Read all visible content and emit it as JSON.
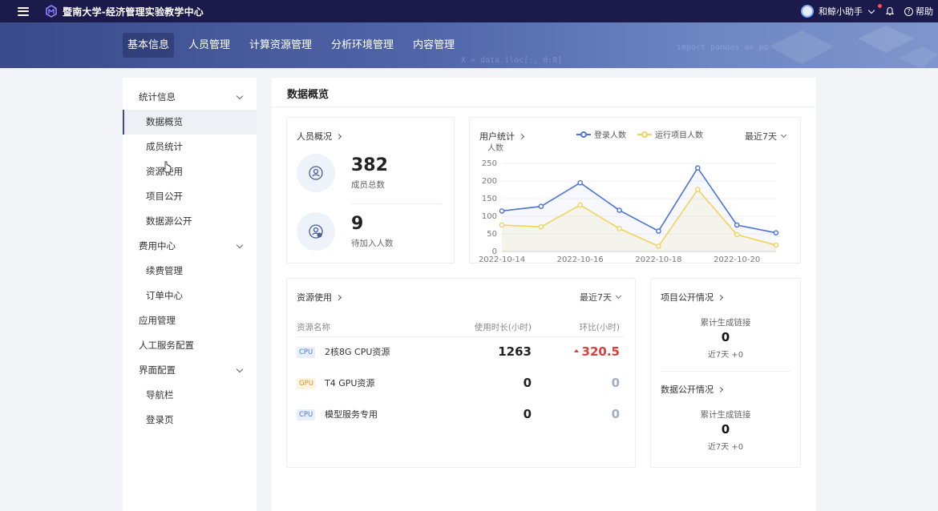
{
  "app": {
    "title": "暨南大学-经济管理实验教学中心"
  },
  "topbar": {
    "user": "和鲸小助手",
    "help": "帮助"
  },
  "nav": {
    "tabs": [
      {
        "label": "基本信息",
        "active": true
      },
      {
        "label": "人员管理"
      },
      {
        "label": "计算资源管理"
      },
      {
        "label": "分析环境管理"
      },
      {
        "label": "内容管理"
      }
    ],
    "deco_code_1": "import pandas as pd",
    "deco_code_2": "X = data.iloc[:, 0:8]"
  },
  "sidebar": {
    "groups": [
      {
        "label": "统计信息",
        "items": [
          "数据概览",
          "成员统计",
          "资源使用",
          "项目公开",
          "数据源公开"
        ]
      },
      {
        "label": "费用中心",
        "items": [
          "续费管理",
          "订单中心"
        ]
      },
      {
        "label": "应用管理"
      },
      {
        "label": "人工服务配置"
      },
      {
        "label": "界面配置",
        "items": [
          "导航栏",
          "登录页"
        ]
      }
    ]
  },
  "main": {
    "title": "数据概览"
  },
  "personnel": {
    "title": "人员概况",
    "members_total": "382",
    "members_label": "成员总数",
    "pending": "9",
    "pending_label": "待加入人数"
  },
  "user_stats": {
    "title": "用户统计",
    "range": "最近7天"
  },
  "chart_data": {
    "type": "line",
    "ylabel": "人数",
    "ylim": [
      0,
      250
    ],
    "yticks": [
      0,
      50,
      100,
      150,
      200,
      250
    ],
    "x": [
      "2022-10-14",
      "2022-10-15",
      "2022-10-16",
      "2022-10-17",
      "2022-10-18",
      "2022-10-19",
      "2022-10-20",
      "2022-10-21"
    ],
    "xtick_labels": [
      "2022-10-14",
      "2022-10-16",
      "2022-10-18",
      "2022-10-20"
    ],
    "series": [
      {
        "name": "登录人数",
        "color": "#4a72d8",
        "values": [
          115,
          128,
          195,
          117,
          58,
          237,
          75,
          53
        ]
      },
      {
        "name": "运行项目人数",
        "color": "#efd35a",
        "values": [
          75,
          70,
          132,
          65,
          15,
          176,
          48,
          18
        ]
      }
    ],
    "grid": true,
    "legend": "top"
  },
  "resources": {
    "title": "资源使用",
    "range": "最近7天",
    "columns": [
      "资源名称",
      "使用时长(小时)",
      "环比(小时)"
    ],
    "rows": [
      {
        "tag": "CPU",
        "name": "2核8G CPU资源",
        "hours": "1263",
        "ratio": "320.5",
        "trend": "up"
      },
      {
        "tag": "GPU",
        "name": "T4 GPU资源",
        "hours": "0",
        "ratio": "0"
      },
      {
        "tag": "CPU",
        "name": "模型服务专用",
        "hours": "0",
        "ratio": "0"
      }
    ]
  },
  "project_public": {
    "title": "项目公开情况",
    "label": "累计生成链接",
    "value": "0",
    "recent": "近7天 +0"
  },
  "data_public": {
    "title": "数据公开情况",
    "label": "累计生成链接",
    "value": "0",
    "recent": "近7天 +0"
  },
  "colors": {
    "brand": "#1b1a4a",
    "accent": "#3e4f9a",
    "line_login": "#4a72d8",
    "line_run": "#efd35a",
    "increase": "#e23b3b"
  }
}
